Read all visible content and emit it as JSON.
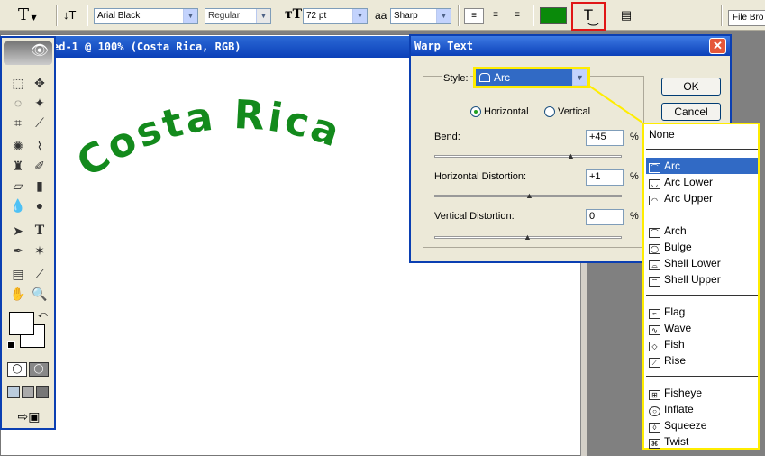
{
  "optionsbar": {
    "tool_icon": "T",
    "font_family": "Arial Black",
    "font_style": "Regular",
    "font_size": "72 pt",
    "aa_icon": "aa",
    "antialias": "Sharp",
    "text_color": "#0a8a0a",
    "file_browser": "File Bro"
  },
  "document": {
    "title": "ed-1 @ 100% (Costa Rica, RGB)",
    "text": "Costa Rica",
    "text_color": "#138a1c"
  },
  "dialog": {
    "title": "Warp Text",
    "style_label": "Style:",
    "style_value": "Arc",
    "ok_label": "OK",
    "cancel_label": "Cancel",
    "horizontal_label": "Horizontal",
    "vertical_label": "Vertical",
    "bend_label": "Bend:",
    "bend_value": "+45",
    "hdist_label": "Horizontal Distortion:",
    "hdist_value": "+1",
    "vdist_label": "Vertical Distortion:",
    "vdist_value": "0",
    "percent": "%"
  },
  "style_menu": {
    "none": "None",
    "items": [
      "Arc",
      "Arc Lower",
      "Arc Upper",
      "Arch",
      "Bulge",
      "Shell Lower",
      "Shell Upper",
      "Flag",
      "Wave",
      "Fish",
      "Rise",
      "Fisheye",
      "Inflate",
      "Squeeze",
      "Twist"
    ],
    "selected": "Arc"
  }
}
